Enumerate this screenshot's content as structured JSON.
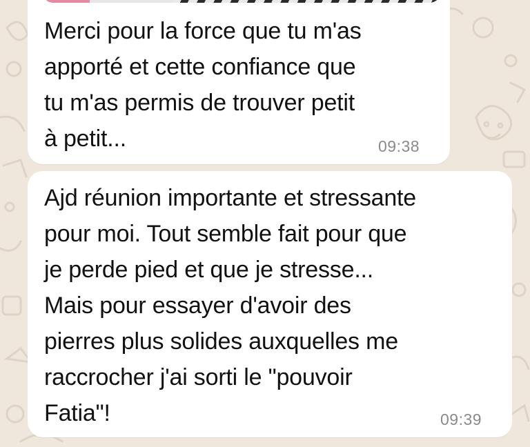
{
  "messages": [
    {
      "lines": [
        "Merci pour la force que tu m'as",
        "apporté et cette confiance que",
        "tu m'as permis de trouver petit",
        "à petit..."
      ],
      "time": "09:38"
    },
    {
      "lines": [
        "Ajd réunion importante et stressante",
        "pour moi. Tout semble fait pour que",
        "je perde pied et que je stresse...",
        "Mais pour essayer d'avoir des",
        "pierres plus solides auxquelles me",
        "raccrocher j'ai sorti le \"pouvoir",
        "Fatia\"!"
      ],
      "time": "09:39"
    }
  ],
  "colors": {
    "wallpaper": "#efe7dc",
    "bubble": "#ffffff",
    "text": "#111111",
    "timestamp": "#8a8a8a"
  }
}
